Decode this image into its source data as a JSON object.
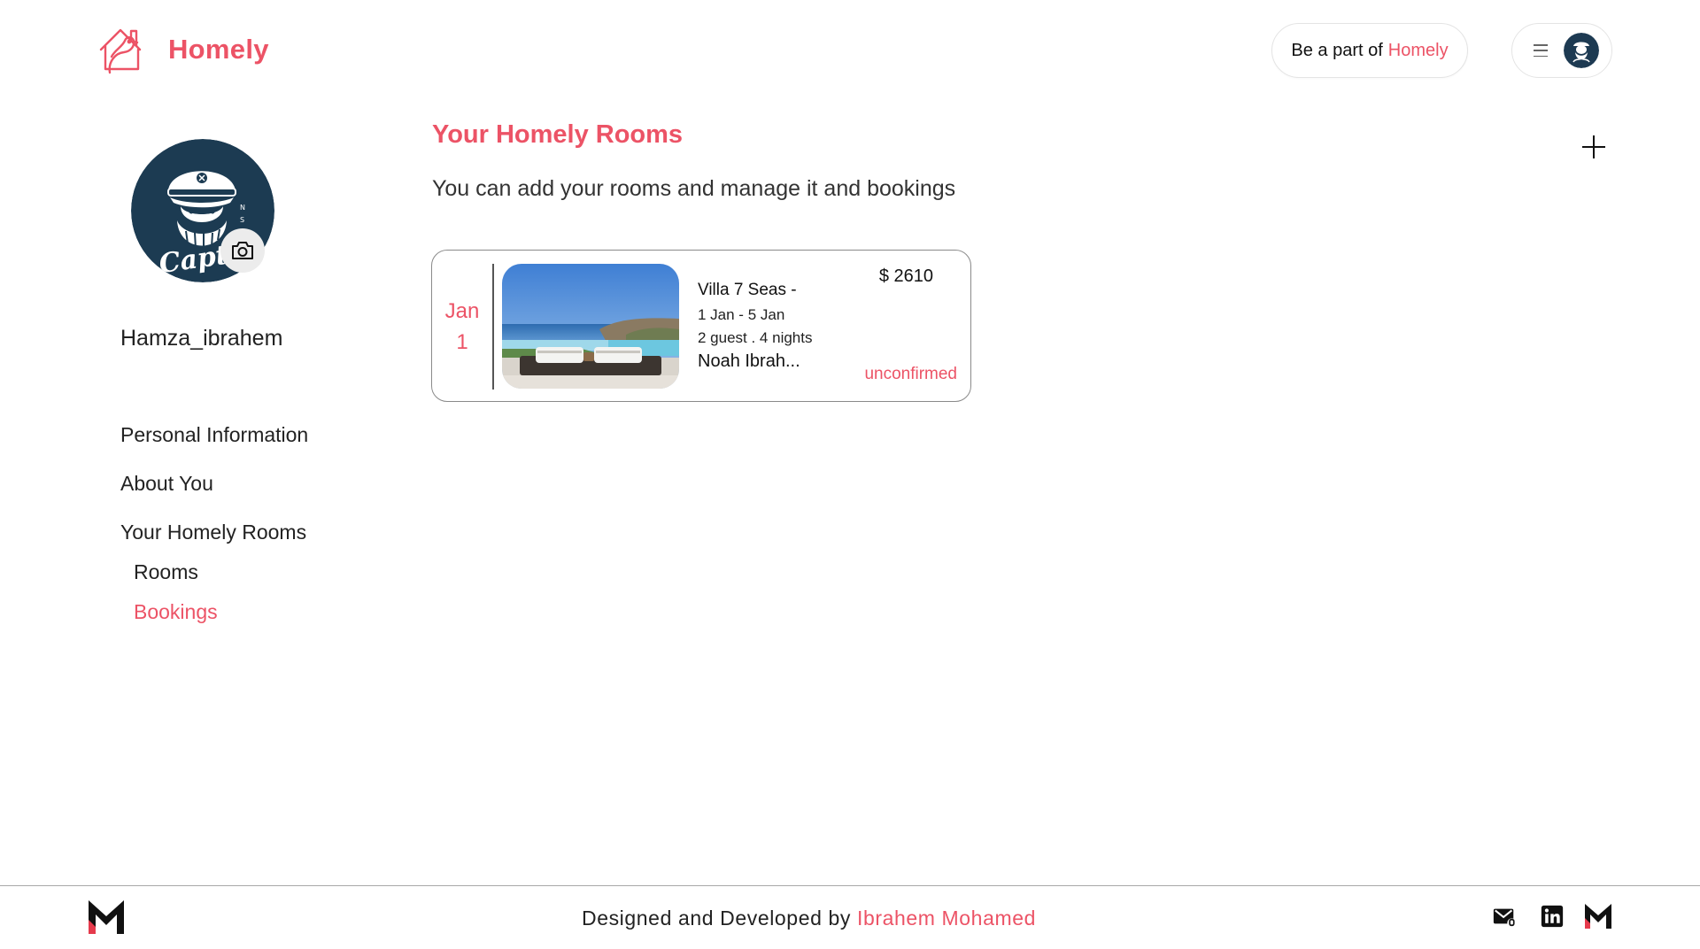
{
  "brand": {
    "name": "Homely",
    "color": "#ec5366",
    "icon": "house-bird-logo-icon"
  },
  "header": {
    "host_cta": {
      "lead": "Be a part of",
      "brand": "Homely"
    },
    "user_menu": {
      "menu_icon": "hamburger-icon",
      "avatar": "captain-avatar"
    }
  },
  "profile": {
    "username": "Hamza_ibrahem",
    "avatar_text": "Captain",
    "camera_icon": "camera-icon"
  },
  "sidebar": {
    "items": [
      {
        "label": "Personal Information",
        "level": 1,
        "active": false
      },
      {
        "label": "About You",
        "level": 1,
        "active": false
      },
      {
        "label": "Your Homely Rooms",
        "level": 1,
        "active": false
      },
      {
        "label": "Rooms",
        "level": 2,
        "active": false
      },
      {
        "label": "Bookings",
        "level": 2,
        "active": true
      }
    ]
  },
  "main": {
    "title": "Your Homely Rooms",
    "subtitle": "You can add your rooms and manage it and bookings",
    "add_icon": "plus-icon",
    "bookings": [
      {
        "month": "Jan",
        "day": "1",
        "room_name": "Villa 7 Seas -",
        "dates": "1 Jan - 5 Jan",
        "guests": "2 guest . 4 nights",
        "guest_name": "Noah Ibrah...",
        "price": "$ 2610",
        "status": "unconfirmed"
      }
    ]
  },
  "footer": {
    "credit_prefix": "Designed and Developed by ",
    "author": "Ibrahem Mohamed",
    "logo_icon": "m-monogram-logo-icon",
    "social": [
      "mail-icon",
      "linkedin-icon",
      "m-monogram-icon"
    ]
  }
}
